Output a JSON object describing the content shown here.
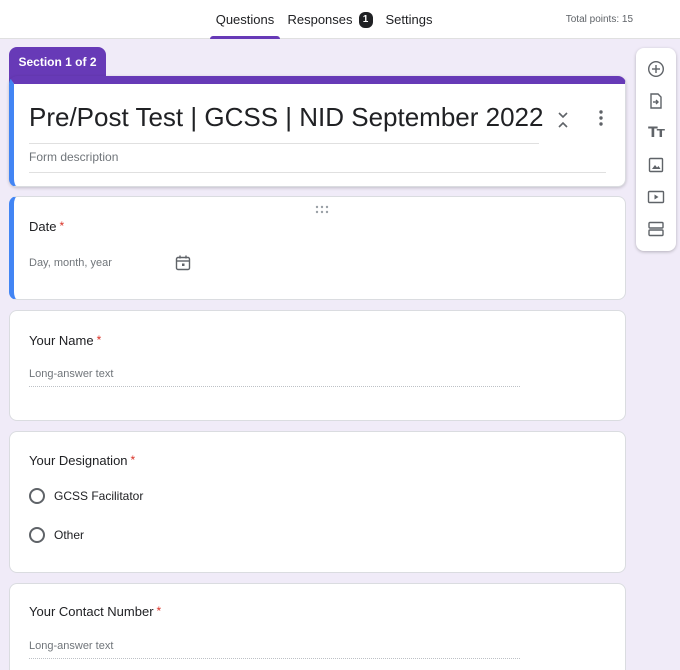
{
  "tabs": {
    "questions": "Questions",
    "responses": "Responses",
    "responses_count": "1",
    "settings": "Settings"
  },
  "total_points": "Total points: 15",
  "section_tag": "Section 1 of 2",
  "form": {
    "title": "Pre/Post Test | GCSS | NID September 2022",
    "description_placeholder": "Form description"
  },
  "questions": [
    {
      "title": "Date",
      "required_mark": "*",
      "placeholder": "Day, month, year"
    },
    {
      "title": "Your Name",
      "required_mark": "*",
      "placeholder": "Long-answer text"
    },
    {
      "title": "Your Designation",
      "required_mark": "*",
      "options": [
        "GCSS Facilitator",
        "Other"
      ]
    },
    {
      "title": "Your Contact Number",
      "required_mark": "*",
      "placeholder": "Long-answer text"
    }
  ],
  "toolbar": {
    "add_question": "add-circle-icon",
    "import_questions": "import-icon",
    "add_title": "Tт",
    "add_image": "image-icon",
    "add_video": "video-icon",
    "add_section": "section-icon"
  },
  "colors": {
    "accent": "#673ab7",
    "focus": "#4285f4",
    "background": "#f0ebf8",
    "required": "#d93025"
  }
}
